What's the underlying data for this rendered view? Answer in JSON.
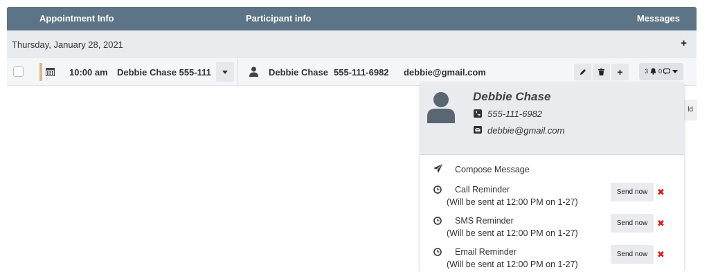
{
  "table": {
    "headers": {
      "appointment": "Appointment Info",
      "participant": "Participant info",
      "messages": "Messages"
    },
    "date_group": {
      "label": "Thursday, January 28, 2021",
      "add": "+"
    },
    "row": {
      "time": "10:00 am",
      "title": "Debbie Chase 555-111",
      "participant_name": "Debbie Chase",
      "participant_phone": "555-111-6982",
      "participant_email": "debbie@gmail.com",
      "plus": "+",
      "message_counts": {
        "call": "3",
        "other": "0"
      }
    },
    "partial_button_text": "ld"
  },
  "popover": {
    "name": "Debbie Chase",
    "phone": "555-111-6982",
    "email": "debbie@gmail.com",
    "compose": "Compose Message",
    "reminders": [
      {
        "label": "Call Reminder",
        "note": "(Will be sent at 12:00 PM on 1-27)",
        "send": "Send now"
      },
      {
        "label": "SMS Reminder",
        "note": "(Will be sent at 12:00 PM on 1-27)",
        "send": "Send now"
      },
      {
        "label": "Email Reminder",
        "note": "(Will be sent at 12:00 PM on 1-27)",
        "send": "Send now"
      }
    ]
  },
  "colors": {
    "header": "#5c7486",
    "accent_bar": "#d7b98a",
    "delete": "#e01b1b"
  },
  "icons": [
    "calendar-icon",
    "person-icon",
    "pencil-icon",
    "trash-icon",
    "bell-icon",
    "phone-icon",
    "envelope-icon",
    "paper-plane-icon",
    "clock-icon",
    "close-icon"
  ]
}
